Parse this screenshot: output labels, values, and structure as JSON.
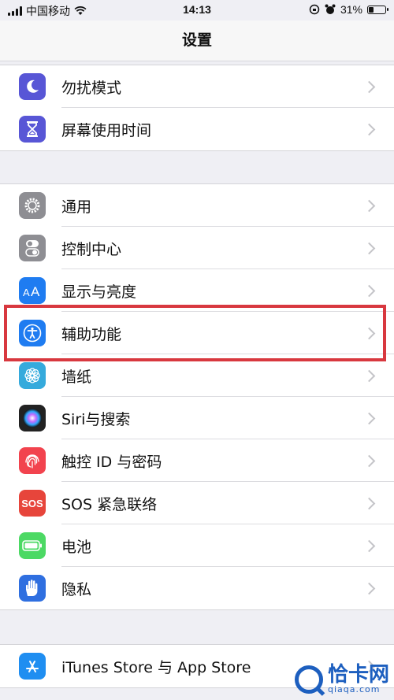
{
  "status_bar": {
    "carrier": "中国移动",
    "time": "14:13",
    "battery": "31%",
    "battery_level": 0.31
  },
  "nav": {
    "title": "设置"
  },
  "groups": [
    {
      "items": [
        {
          "label": "勿扰模式",
          "icon": "moon-icon",
          "color": "#5856d6"
        },
        {
          "label": "屏幕使用时间",
          "icon": "hourglass-icon",
          "color": "#5856d6"
        }
      ]
    },
    {
      "items": [
        {
          "label": "通用",
          "icon": "gear-icon",
          "color": "#8e8e93"
        },
        {
          "label": "控制中心",
          "icon": "toggles-icon",
          "color": "#8e8e93"
        },
        {
          "label": "显示与亮度",
          "icon": "text-size-icon",
          "color": "#1f7cf1"
        },
        {
          "label": "辅助功能",
          "icon": "accessibility-icon",
          "color": "#1f7cf1"
        },
        {
          "label": "墙纸",
          "icon": "flower-icon",
          "color": "#35aadc"
        },
        {
          "label": "Siri与搜索",
          "icon": "siri-icon",
          "color": "#222222"
        },
        {
          "label": "触控 ID 与密码",
          "icon": "fingerprint-icon",
          "color": "#f2434e"
        },
        {
          "label": "SOS 紧急联络",
          "icon": "sos-icon",
          "color": "#e7453b",
          "icon_text": "SOS"
        },
        {
          "label": "电池",
          "icon": "battery-icon",
          "color": "#4cd964"
        },
        {
          "label": "隐私",
          "icon": "hand-icon",
          "color": "#2f6fe0"
        }
      ]
    },
    {
      "items": [
        {
          "label": "iTunes Store 与 App Store",
          "icon": "app-store-icon",
          "color": "#1f8ef1"
        }
      ]
    }
  ],
  "watermark": {
    "name": "恰卡网",
    "url": "qiaqa.com"
  }
}
